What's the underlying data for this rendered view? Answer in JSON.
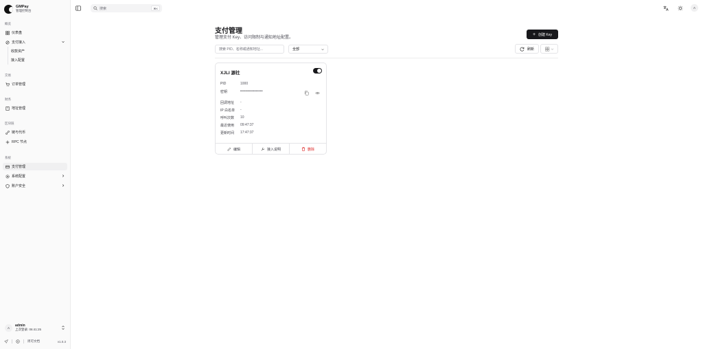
{
  "brand": {
    "name": "GMPay",
    "subtitle": "管理控制台"
  },
  "sidebar": {
    "groups": [
      {
        "label": "概览"
      },
      {
        "label": "交易"
      },
      {
        "label": "财务"
      },
      {
        "label": "区块链"
      },
      {
        "label": "系统"
      }
    ],
    "items": {
      "dashboard": "仪表盘",
      "payment_access": "支付接入",
      "receiving_assets": "收款资产",
      "access_config": "接入配置",
      "orders": "订单管理",
      "addresses": "地址管理",
      "chains_tokens": "链与代币",
      "rpc_nodes": "RPC 节点",
      "payment_mgmt": "支付管理",
      "system_config": "系统配置",
      "account_security": "账户安全"
    },
    "user": {
      "avatar_initial": "A",
      "name": "admin",
      "last_login": "上次登录: 06:41:25"
    },
    "footer": {
      "docs": "周可文档",
      "version": "v1.0.3"
    }
  },
  "topbar": {
    "search_placeholder": "搜索",
    "search_shortcut": "⌘K",
    "avatar_initial": "A"
  },
  "main": {
    "title": "支付管理",
    "subtitle": "管理支付 Key、访问限制与通知地址配置。",
    "create_button": "创建 Key",
    "filter_placeholder": "搜索 PID、名称或通知地址...",
    "filter_select": "全部",
    "refresh_button": "刷新"
  },
  "card": {
    "title": "XJLI 源社",
    "enabled": true,
    "rows": [
      {
        "label": "PID",
        "value": "1000"
      },
      {
        "label": "密钥",
        "value": "••••••••••••••••"
      },
      {
        "label": "回调地址",
        "value": "-"
      },
      {
        "label": "IP 白名单",
        "value": "-"
      },
      {
        "label": "呼叫次数",
        "value": "10"
      },
      {
        "label": "最近使用",
        "value": "09:47:37"
      },
      {
        "label": "更新时间",
        "value": "17:47:37"
      }
    ],
    "actions": {
      "edit": "编辑",
      "docs": "接入说明",
      "delete": "删除"
    }
  }
}
